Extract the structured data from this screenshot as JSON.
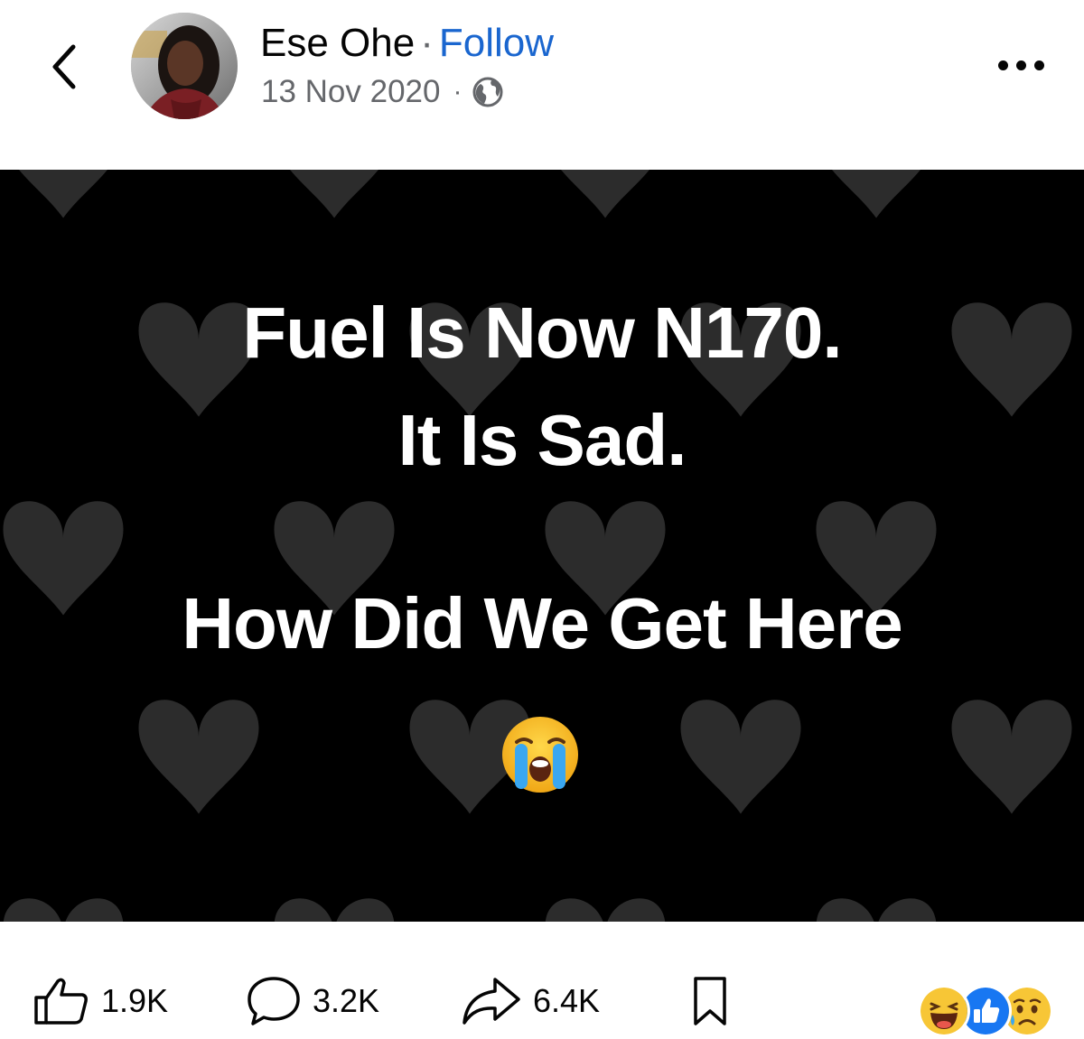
{
  "header": {
    "author_name": "Ese Ohe",
    "separator": "·",
    "follow_label": "Follow",
    "date": "13 Nov 2020",
    "audience_icon": "globe-icon"
  },
  "post": {
    "lines": [
      "Fuel Is Now N170.",
      "It Is Sad.",
      "How Did We Get Here"
    ],
    "emoji": "loudly-crying-face",
    "background": "dark hearts pattern"
  },
  "actions": {
    "likes": "1.9K",
    "comments": "3.2K",
    "shares": "6.4K"
  },
  "reactions": [
    "haha",
    "like",
    "sad"
  ],
  "colors": {
    "follow": "#1a66cf",
    "secondary_text": "#65676b",
    "like_reaction": "#1877f2",
    "image_bg": "#000000",
    "heart": "#2c2c2c"
  }
}
